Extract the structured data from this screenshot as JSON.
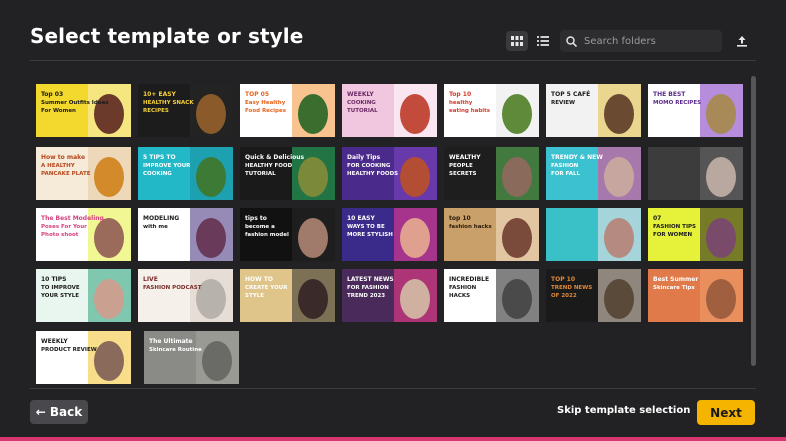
{
  "header": {
    "title": "Select template or style",
    "search_placeholder": "Search folders"
  },
  "footer": {
    "back_label": "Back",
    "skip_label": "Skip template selection",
    "next_label": "Next"
  },
  "templates": [
    [
      "Top 03",
      "Summer Outfits Ideas",
      "For Women"
    ],
    [
      "10+ EASY",
      "HEALTHY SNACK",
      "RECIPES"
    ],
    [
      "TOP 05",
      "Easy Healthy",
      "Food Recipes"
    ],
    [
      "WEEKLY",
      "COOKING",
      "TUTORIAL"
    ],
    [
      "Top 10",
      "healthy",
      "eating habits"
    ],
    [
      "TOP 5 CAFÉ",
      "REVIEW",
      ""
    ],
    [
      "THE BEST",
      "MOMO RECIPES",
      ""
    ],
    [
      "How to make",
      "A HEALTHY",
      "PANCAKE PLATE"
    ],
    [
      "5 TIPS TO",
      "IMPROVE YOUR",
      "COOKING"
    ],
    [
      "Quick & Delicious",
      "HEALTHY FOOD",
      "TUTORIAL"
    ],
    [
      "Daily Tips",
      "FOR COOKING",
      "HEALTHY FOODS"
    ],
    [
      "WEALTHY",
      "PEOPLE",
      "SECRETS"
    ],
    [
      "TRENDY & NEW",
      "FASHION",
      "FOR FALL",
      "",
      ""
    ],
    [
      "",
      "",
      ""
    ],
    [
      "The Best Modeling",
      "Poses For Your",
      "Photo shoot"
    ],
    [
      "MODELING",
      "with me",
      ""
    ],
    [
      "tips to",
      "become a",
      "fashion model"
    ],
    [
      "10 EASY",
      "WAYS TO BE",
      "MORE STYLISH"
    ],
    [
      "top 10",
      "fashion hacks",
      ""
    ],
    [
      "",
      "",
      ""
    ],
    [
      "07",
      "FASHION TIPS",
      "FOR WOMEN"
    ],
    [
      "10 TIPS",
      "TO IMPROVE",
      "YOUR STYLE"
    ],
    [
      "LIVE",
      "FASHION PODCAST",
      ""
    ],
    [
      "HOW TO",
      "CREATE YOUR",
      "STYLE"
    ],
    [
      "LATEST NEWS",
      "FOR FASHION",
      "TREND 2023"
    ],
    [
      "INCREDIBLE",
      "FASHION",
      "HACKS"
    ],
    [
      "TOP 10",
      "TREND NEWS",
      "OF 2022"
    ],
    [
      "Best Summer",
      "Skincare Tips",
      ""
    ],
    [
      "WEEKLY",
      "PRODUCT REVIEW",
      ""
    ],
    [
      "The Ultimate",
      "Skincare Routine",
      ""
    ]
  ]
}
